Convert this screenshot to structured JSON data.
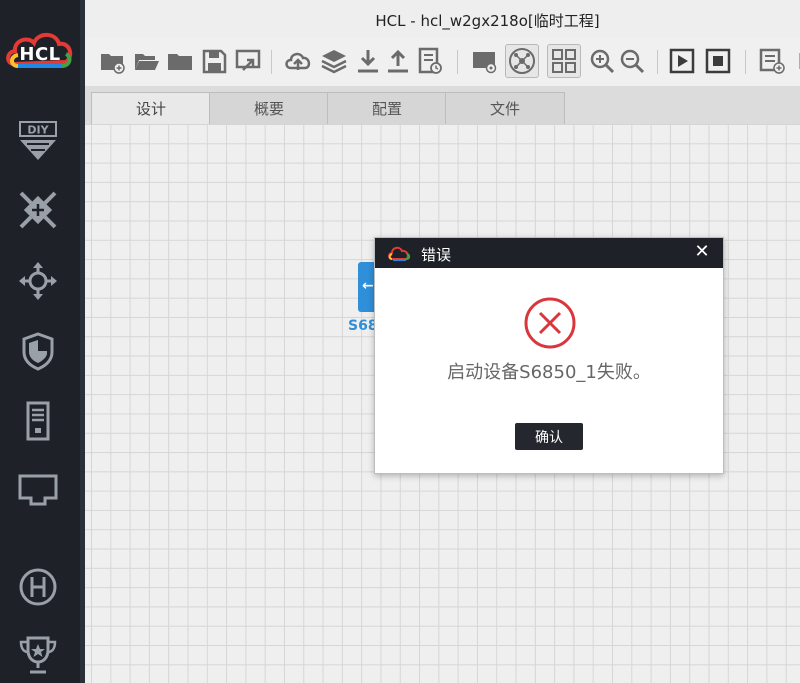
{
  "app": {
    "logo_text": "HCL",
    "title": "HCL - hcl_w2gx218o[临时工程]"
  },
  "sidebar": {
    "items": [
      {
        "name": "diy-icon"
      },
      {
        "name": "switch-icon"
      },
      {
        "name": "router-icon"
      },
      {
        "name": "firewall-icon"
      },
      {
        "name": "server-icon"
      },
      {
        "name": "terminal-icon"
      },
      {
        "name": "hub-icon"
      },
      {
        "name": "trophy-icon"
      }
    ]
  },
  "toolbar": {
    "icons": [
      "new-project-icon",
      "open-project-icon",
      "folder-icon",
      "save-icon",
      "export-icon",
      "cloud-upload-icon",
      "layers-icon",
      "download-icon",
      "upload-icon",
      "log-icon",
      "screenshot-icon",
      "topology-icon",
      "grid-icon",
      "zoom-in-icon",
      "zoom-out-icon",
      "start-icon",
      "stop-icon",
      "add-device-icon",
      "collapse-icon"
    ]
  },
  "tabs": [
    {
      "label": "设计"
    },
    {
      "label": "概要"
    },
    {
      "label": "配置"
    },
    {
      "label": "文件"
    }
  ],
  "canvas": {
    "device_label": "S68"
  },
  "dialog": {
    "title": "错误",
    "close_glyph": "✕",
    "message": "启动设备S6850_1失败。",
    "ok_label": "确认"
  },
  "colors": {
    "sidebar_bg": "#1e2228",
    "accent_blue": "#2f8fd8",
    "error_red": "#d9363e"
  }
}
